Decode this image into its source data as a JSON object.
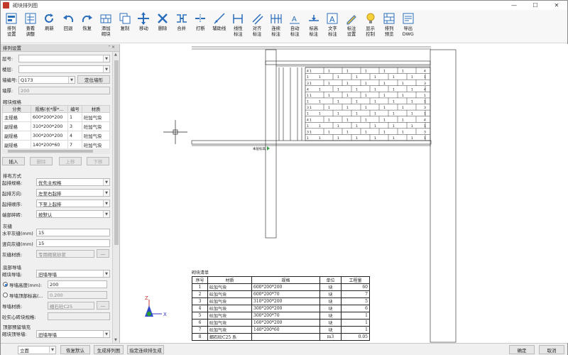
{
  "window": {
    "title": "砌块排列图",
    "controls": [
      "—",
      "☐",
      "✕"
    ]
  },
  "toolbar": {
    "buttons": [
      {
        "label": "排列\n设置",
        "icon": "arrange-settings-icon"
      },
      {
        "label": "查看\n调整",
        "icon": "view-adjust-icon"
      },
      {
        "label": "刷新",
        "icon": "refresh-icon"
      },
      {
        "label": "回退",
        "icon": "undo-icon"
      },
      {
        "label": "恢复",
        "icon": "redo-icon"
      },
      {
        "label": "添加\n砌块",
        "icon": "add-block-icon"
      },
      {
        "label": "复制",
        "icon": "copy-icon"
      },
      {
        "label": "移动",
        "icon": "move-icon"
      },
      {
        "label": "删除",
        "icon": "delete-icon"
      },
      {
        "label": "合并",
        "icon": "merge-icon"
      },
      {
        "label": "打断",
        "icon": "break-icon"
      },
      {
        "label": "辅助线",
        "icon": "guide-line-icon"
      },
      {
        "label": "线性\n标注",
        "icon": "linear-dim-icon"
      },
      {
        "label": "对齐\n标注",
        "icon": "aligned-dim-icon"
      },
      {
        "label": "连续\n标注",
        "icon": "continuous-dim-icon"
      },
      {
        "label": "自动\n标注",
        "icon": "auto-dim-icon"
      },
      {
        "label": "标高\n标注",
        "icon": "elevation-dim-icon"
      },
      {
        "label": "文字\n标注",
        "icon": "text-note-icon"
      },
      {
        "label": "标注\n设置",
        "icon": "note-settings-icon"
      },
      {
        "label": "显示\n控制",
        "icon": "display-control-icon"
      },
      {
        "label": "排列\n预览",
        "icon": "arrange-preview-icon"
      },
      {
        "label": "导出\nDWG",
        "icon": "export-dwg-icon"
      }
    ]
  },
  "panel": {
    "title": "排列设置",
    "pin": "ᐩ ×",
    "fields": {
      "floor_label": "层号:",
      "floor_value": "",
      "story_label": "楼层:",
      "story_value": "",
      "wall_no_label": "墙编号:",
      "wall_no_value": "Q173",
      "locate_button": "定位墙形",
      "wall_thick_label": "墙厚:",
      "wall_thick_value": "200"
    },
    "spec_section": "砌块规格",
    "spec_headers": [
      "分类",
      "规格(长*厚*...",
      "编号",
      "材质"
    ],
    "spec_rows": [
      [
        "主规格",
        "600*200*200",
        "1",
        "砼加气块"
      ],
      [
        "副规格",
        "310*200*200",
        "3",
        "砼加气块"
      ],
      [
        "副规格",
        "300*200*200",
        "4",
        "砼加气块"
      ],
      [
        "副规格",
        "140*200*60",
        "7",
        "砼加气块"
      ]
    ],
    "spec_buttons": [
      "插入",
      "删除",
      "上移",
      "下移"
    ],
    "layout_section": "排布方式",
    "layout": [
      {
        "label": "起排规格:",
        "value": "优先主规格"
      },
      {
        "label": "起排方向:",
        "value": "左至右起排"
      },
      {
        "label": "起排顺序:",
        "value": "下至上起排"
      },
      {
        "label": "端部碎砖:",
        "value": "按默认"
      }
    ],
    "joint_section": "灰缝",
    "joint": {
      "h_label": "水平灰缝(mm)",
      "h_value": "15",
      "v_label": "竖向灰缝(mm)",
      "v_value": "15",
      "mat_label": "灰缝材质:",
      "mat_value": "专用砌筑砂浆",
      "mat_btn": "..."
    },
    "bottom_section": "底部导墙",
    "bottom": {
      "type_label": "砌块导墙:",
      "type_value": "旧墙导墙",
      "height_label": "导墙高度(mm):",
      "height_value": "200",
      "top_label": "导墙顶部标高(...",
      "top_value": "0.200",
      "mat_label": "导墙材质:",
      "mat_value": "细石砼C25",
      "mat_btn": "...",
      "solid_label": "砼实心砖块规格:",
      "solid_value": ""
    },
    "top_section": "顶部预留填充",
    "top": {
      "label": "砌块顶导墙:",
      "value": "旧墙导墙"
    }
  },
  "canvas": {
    "axis": {
      "x": "X",
      "y": "Y",
      "z": "Z"
    },
    "elevation_label": "本层标高",
    "row_numbers": [
      "4",
      "1",
      "3",
      "4",
      "1",
      "1",
      "3",
      "1",
      "4",
      "1",
      "3",
      "1"
    ],
    "schedule": {
      "title": "砌块清单",
      "headers": [
        "序号",
        "材质",
        "规格",
        "单位",
        "工程量"
      ],
      "rows": [
        [
          "1",
          "砼加气块",
          "600*200*200",
          "块",
          "60"
        ],
        [
          "2",
          "砼加气块",
          "600*200*70",
          "块",
          "7"
        ],
        [
          "3",
          "砼加气块",
          "310*200*200",
          "块",
          "5"
        ],
        [
          "4",
          "砼加气块",
          "300*200*200",
          "块",
          "6"
        ],
        [
          "5",
          "砼加气块",
          "300*200*70",
          "块",
          "1"
        ],
        [
          "6",
          "砼加气块",
          "160*200*200",
          "块",
          "1"
        ],
        [
          "7",
          "砼加气块",
          "140*200*60",
          "块",
          "1"
        ],
        [
          "8",
          "细石砼C25 系",
          "",
          "m3",
          "0.05"
        ]
      ]
    }
  },
  "bottombar": {
    "view_value": "立面",
    "buttons": [
      "恢复默认",
      "生成排列图",
      "指定连续排生成"
    ],
    "ok": "确定",
    "cancel": "取消"
  }
}
